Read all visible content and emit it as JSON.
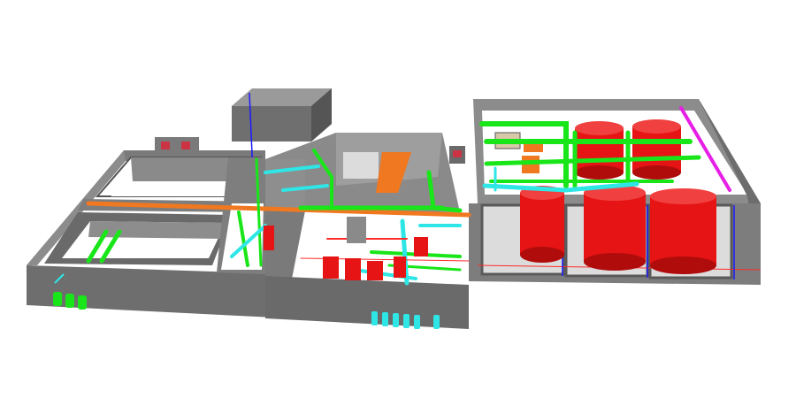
{
  "scene": {
    "description_visible_text": "",
    "colors": {
      "background": "#ffffff",
      "wall_dark": "#5a5a5a",
      "wall_mid": "#8a8a8a",
      "wall_light": "#a6a6a6",
      "floor": "#ffffff",
      "pipe_green": "#19e619",
      "pipe_green_dark": "#0b9a0b",
      "pipe_cyan": "#2ee6e6",
      "tank_red": "#e61414",
      "tank_red_dark": "#b00c0c",
      "orange": "#f07820",
      "magenta": "#e61ee6",
      "blue_line": "#1a1aff",
      "red_line": "#ff2a2a"
    },
    "components": [
      "large-red-storage-tanks",
      "green-piping",
      "cyan-piping",
      "orange-duct",
      "pump-room-red-equipment",
      "rooftop-box",
      "magenta-pipe"
    ]
  }
}
